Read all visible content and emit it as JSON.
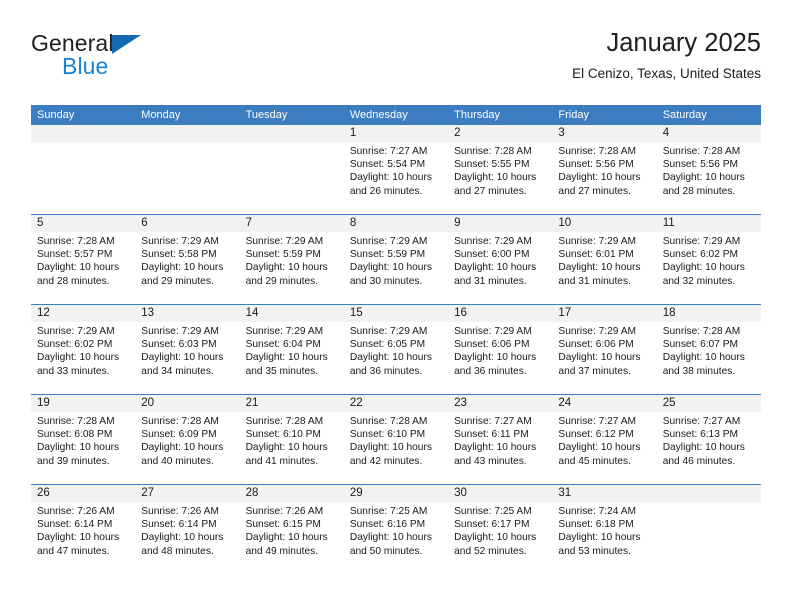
{
  "brand": {
    "name_part1": "General",
    "name_part2": "Blue",
    "logo_icon": "triangle-logo-icon"
  },
  "header": {
    "title": "January 2025",
    "location": "El Cenizo, Texas, United States"
  },
  "colors": {
    "header_blue": "#3b7dc0",
    "brand_dark": "#231f20",
    "brand_blue": "#1683d4",
    "daynum_bg": "#f2f2f2"
  },
  "calendar": {
    "weekdays": [
      "Sunday",
      "Monday",
      "Tuesday",
      "Wednesday",
      "Thursday",
      "Friday",
      "Saturday"
    ],
    "weeks": [
      [
        {
          "day": "",
          "sunrise": "",
          "sunset": "",
          "daylight": "",
          "empty": true
        },
        {
          "day": "",
          "sunrise": "",
          "sunset": "",
          "daylight": "",
          "empty": true
        },
        {
          "day": "",
          "sunrise": "",
          "sunset": "",
          "daylight": "",
          "empty": true
        },
        {
          "day": "1",
          "sunrise": "Sunrise: 7:27 AM",
          "sunset": "Sunset: 5:54 PM",
          "daylight": "Daylight: 10 hours and 26 minutes.",
          "empty": false
        },
        {
          "day": "2",
          "sunrise": "Sunrise: 7:28 AM",
          "sunset": "Sunset: 5:55 PM",
          "daylight": "Daylight: 10 hours and 27 minutes.",
          "empty": false
        },
        {
          "day": "3",
          "sunrise": "Sunrise: 7:28 AM",
          "sunset": "Sunset: 5:56 PM",
          "daylight": "Daylight: 10 hours and 27 minutes.",
          "empty": false
        },
        {
          "day": "4",
          "sunrise": "Sunrise: 7:28 AM",
          "sunset": "Sunset: 5:56 PM",
          "daylight": "Daylight: 10 hours and 28 minutes.",
          "empty": false
        }
      ],
      [
        {
          "day": "5",
          "sunrise": "Sunrise: 7:28 AM",
          "sunset": "Sunset: 5:57 PM",
          "daylight": "Daylight: 10 hours and 28 minutes.",
          "empty": false
        },
        {
          "day": "6",
          "sunrise": "Sunrise: 7:29 AM",
          "sunset": "Sunset: 5:58 PM",
          "daylight": "Daylight: 10 hours and 29 minutes.",
          "empty": false
        },
        {
          "day": "7",
          "sunrise": "Sunrise: 7:29 AM",
          "sunset": "Sunset: 5:59 PM",
          "daylight": "Daylight: 10 hours and 29 minutes.",
          "empty": false
        },
        {
          "day": "8",
          "sunrise": "Sunrise: 7:29 AM",
          "sunset": "Sunset: 5:59 PM",
          "daylight": "Daylight: 10 hours and 30 minutes.",
          "empty": false
        },
        {
          "day": "9",
          "sunrise": "Sunrise: 7:29 AM",
          "sunset": "Sunset: 6:00 PM",
          "daylight": "Daylight: 10 hours and 31 minutes.",
          "empty": false
        },
        {
          "day": "10",
          "sunrise": "Sunrise: 7:29 AM",
          "sunset": "Sunset: 6:01 PM",
          "daylight": "Daylight: 10 hours and 31 minutes.",
          "empty": false
        },
        {
          "day": "11",
          "sunrise": "Sunrise: 7:29 AM",
          "sunset": "Sunset: 6:02 PM",
          "daylight": "Daylight: 10 hours and 32 minutes.",
          "empty": false
        }
      ],
      [
        {
          "day": "12",
          "sunrise": "Sunrise: 7:29 AM",
          "sunset": "Sunset: 6:02 PM",
          "daylight": "Daylight: 10 hours and 33 minutes.",
          "empty": false
        },
        {
          "day": "13",
          "sunrise": "Sunrise: 7:29 AM",
          "sunset": "Sunset: 6:03 PM",
          "daylight": "Daylight: 10 hours and 34 minutes.",
          "empty": false
        },
        {
          "day": "14",
          "sunrise": "Sunrise: 7:29 AM",
          "sunset": "Sunset: 6:04 PM",
          "daylight": "Daylight: 10 hours and 35 minutes.",
          "empty": false
        },
        {
          "day": "15",
          "sunrise": "Sunrise: 7:29 AM",
          "sunset": "Sunset: 6:05 PM",
          "daylight": "Daylight: 10 hours and 36 minutes.",
          "empty": false
        },
        {
          "day": "16",
          "sunrise": "Sunrise: 7:29 AM",
          "sunset": "Sunset: 6:06 PM",
          "daylight": "Daylight: 10 hours and 36 minutes.",
          "empty": false
        },
        {
          "day": "17",
          "sunrise": "Sunrise: 7:29 AM",
          "sunset": "Sunset: 6:06 PM",
          "daylight": "Daylight: 10 hours and 37 minutes.",
          "empty": false
        },
        {
          "day": "18",
          "sunrise": "Sunrise: 7:28 AM",
          "sunset": "Sunset: 6:07 PM",
          "daylight": "Daylight: 10 hours and 38 minutes.",
          "empty": false
        }
      ],
      [
        {
          "day": "19",
          "sunrise": "Sunrise: 7:28 AM",
          "sunset": "Sunset: 6:08 PM",
          "daylight": "Daylight: 10 hours and 39 minutes.",
          "empty": false
        },
        {
          "day": "20",
          "sunrise": "Sunrise: 7:28 AM",
          "sunset": "Sunset: 6:09 PM",
          "daylight": "Daylight: 10 hours and 40 minutes.",
          "empty": false
        },
        {
          "day": "21",
          "sunrise": "Sunrise: 7:28 AM",
          "sunset": "Sunset: 6:10 PM",
          "daylight": "Daylight: 10 hours and 41 minutes.",
          "empty": false
        },
        {
          "day": "22",
          "sunrise": "Sunrise: 7:28 AM",
          "sunset": "Sunset: 6:10 PM",
          "daylight": "Daylight: 10 hours and 42 minutes.",
          "empty": false
        },
        {
          "day": "23",
          "sunrise": "Sunrise: 7:27 AM",
          "sunset": "Sunset: 6:11 PM",
          "daylight": "Daylight: 10 hours and 43 minutes.",
          "empty": false
        },
        {
          "day": "24",
          "sunrise": "Sunrise: 7:27 AM",
          "sunset": "Sunset: 6:12 PM",
          "daylight": "Daylight: 10 hours and 45 minutes.",
          "empty": false
        },
        {
          "day": "25",
          "sunrise": "Sunrise: 7:27 AM",
          "sunset": "Sunset: 6:13 PM",
          "daylight": "Daylight: 10 hours and 46 minutes.",
          "empty": false
        }
      ],
      [
        {
          "day": "26",
          "sunrise": "Sunrise: 7:26 AM",
          "sunset": "Sunset: 6:14 PM",
          "daylight": "Daylight: 10 hours and 47 minutes.",
          "empty": false
        },
        {
          "day": "27",
          "sunrise": "Sunrise: 7:26 AM",
          "sunset": "Sunset: 6:14 PM",
          "daylight": "Daylight: 10 hours and 48 minutes.",
          "empty": false
        },
        {
          "day": "28",
          "sunrise": "Sunrise: 7:26 AM",
          "sunset": "Sunset: 6:15 PM",
          "daylight": "Daylight: 10 hours and 49 minutes.",
          "empty": false
        },
        {
          "day": "29",
          "sunrise": "Sunrise: 7:25 AM",
          "sunset": "Sunset: 6:16 PM",
          "daylight": "Daylight: 10 hours and 50 minutes.",
          "empty": false
        },
        {
          "day": "30",
          "sunrise": "Sunrise: 7:25 AM",
          "sunset": "Sunset: 6:17 PM",
          "daylight": "Daylight: 10 hours and 52 minutes.",
          "empty": false
        },
        {
          "day": "31",
          "sunrise": "Sunrise: 7:24 AM",
          "sunset": "Sunset: 6:18 PM",
          "daylight": "Daylight: 10 hours and 53 minutes.",
          "empty": false
        },
        {
          "day": "",
          "sunrise": "",
          "sunset": "",
          "daylight": "",
          "empty": true
        }
      ]
    ]
  }
}
